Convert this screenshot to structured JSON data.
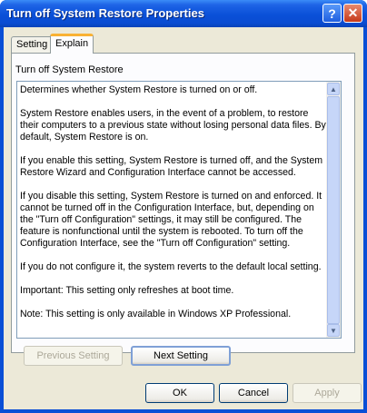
{
  "window": {
    "title": "Turn off System Restore Properties",
    "help_glyph": "?",
    "close_glyph": "✕"
  },
  "tabs": [
    {
      "label": "Setting"
    },
    {
      "label": "Explain"
    }
  ],
  "panel": {
    "title": "Turn off System Restore",
    "paragraphs": [
      "Determines whether System Restore is turned on or off.",
      "System Restore enables users, in the event of a problem, to restore their computers to a previous state without losing personal data files. By default, System Restore is on.",
      "If you enable this setting, System Restore is turned off, and the System Restore Wizard and Configuration Interface cannot be accessed.",
      "If you disable this setting, System Restore is turned on and enforced. It cannot be turned off in the Configuration Interface, but, depending on the \"Turn off Configuration\" settings, it may still be configured. The feature is nonfunctional until the system is rebooted. To turn off the Configuration Interface, see the \"Turn off Configuration\" setting.",
      "If you do not configure it, the system reverts to the default local setting.",
      "Important: This setting only refreshes at boot time.",
      "Note: This setting is only available in Windows XP Professional."
    ]
  },
  "scrollbar": {
    "up_glyph": "▲",
    "down_glyph": "▼"
  },
  "buttons": {
    "previous": "Previous Setting",
    "next": "Next Setting",
    "ok": "OK",
    "cancel": "Cancel",
    "apply": "Apply"
  }
}
